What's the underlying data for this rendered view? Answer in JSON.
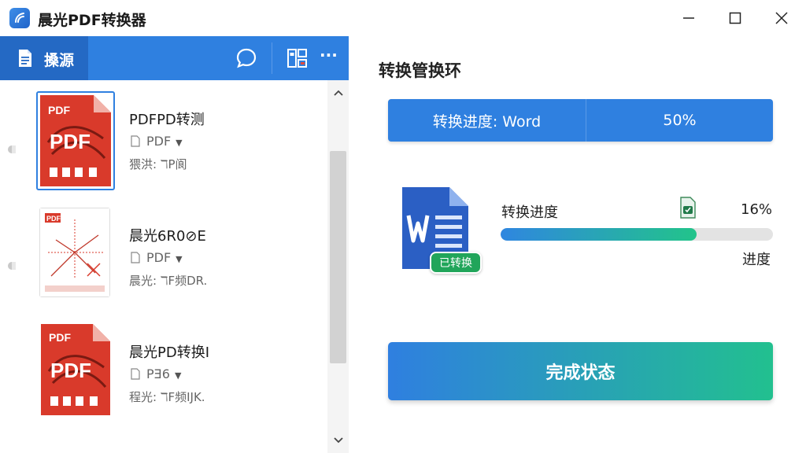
{
  "app": {
    "title": "晨光PDF转换器"
  },
  "left_toolbar": {
    "tab_label": "搡源",
    "more_label": "···"
  },
  "file_list": {
    "items": [
      {
        "name": "PDFPD转测",
        "type": "PDF",
        "meta": "猥洪: ℸP阆",
        "thumb_badge": "PDF",
        "thumb_big": "PDF"
      },
      {
        "name": "晨光6R0⊘E",
        "type": "PDF",
        "meta": "晨光: ℸF频DR.",
        "thumb_badge": "PDF",
        "thumb_big": ""
      },
      {
        "name": "晨光PD转换I",
        "type": "PƎ6",
        "meta": "程光: ℸF频IJK.",
        "thumb_badge": "PDF",
        "thumb_big": "PDF"
      }
    ]
  },
  "right_panel": {
    "title": "转换管换环",
    "header_left": "转换进度: Word",
    "header_right": "50%",
    "badge": "已转换",
    "conversion_label": "转换进度",
    "conversion_percent": "16%",
    "progress_value": 0.72,
    "progress_word": "进度",
    "complete_button": "完成状态"
  },
  "colors": {
    "accent_blue": "#2f80e0",
    "accent_green": "#22c48a",
    "pdf_red": "#d93a2b",
    "word_blue": "#2b5fc4"
  },
  "icons": {
    "app": "app-logo-icon",
    "doc": "document-icon",
    "chat": "chat-bubble-icon",
    "layout": "layout-grid-icon",
    "more": "more-dots-icon"
  }
}
